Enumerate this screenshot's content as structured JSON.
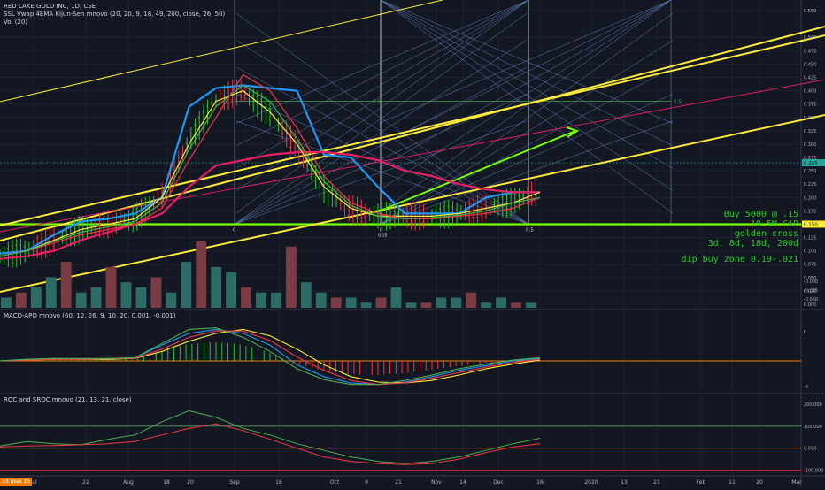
{
  "header": {
    "symbol_line": "RED LAKE GOLD INC, 1D, CSE",
    "indicator_1": "SSL Vwap 4EMA Kijun-Sen mnovo (20, 20, 9, 18, 49, 200, close, 26, 50)",
    "indicator_2": "Vol (20)"
  },
  "panes": {
    "macd_label": "MACD-APO mnovo (60, 12, 26, 9, 10, 20, 0.001, -0.001)",
    "roc_label": "ROC and SROC mnovo (21, 13, 21, close)"
  },
  "annotations": {
    "line1": "Buy 5000 @ .15",
    "line2": "10.5M CAP",
    "line3": "golden cross",
    "line4": "3d, 8d, 18d, 200d",
    "line5": "dip buy zone 0.19-.021"
  },
  "fib_labels": [
    "0.5",
    "0.5",
    "0.5",
    "0",
    "0",
    "0.5",
    "005"
  ],
  "bottom_left_badge": "1d max 15",
  "chart_data": [
    {
      "type": "line",
      "pane": "price",
      "x_ticks": [
        "Jul",
        "22",
        "Aug",
        "18",
        "20",
        "Sep",
        "16",
        "Oct",
        "9",
        "21",
        "Nov",
        "14",
        "Dec",
        "16",
        "2020",
        "13",
        "21",
        "Feb",
        "11",
        "20",
        "Mar"
      ],
      "y_ticks": [
        0.55,
        0.5,
        0.475,
        0.45,
        0.425,
        0.4,
        0.375,
        0.35,
        0.325,
        0.3,
        0.275,
        0.25,
        0.225,
        0.2,
        0.175,
        0.15,
        0.125,
        0.1,
        0.075,
        0.05,
        0.025,
        0.0
      ],
      "price_badges": [
        {
          "value": "0.265",
          "color": "#26a69a"
        },
        {
          "value": "0.150",
          "color": "#ffeb3b"
        }
      ],
      "horizontal_lines": [
        0.15,
        0.265
      ],
      "ylim": [
        0.0,
        0.56
      ],
      "series": [
        {
          "color": "#2196f3",
          "values": [
            0.095,
            0.1,
            0.13,
            0.155,
            0.16,
            0.17,
            0.2,
            0.37,
            0.405,
            0.41,
            0.405,
            0.4,
            0.28,
            0.275,
            0.22,
            0.17,
            0.17,
            0.17,
            0.2,
            0.21,
            0.21
          ]
        },
        {
          "color": "#e91e63",
          "values": [
            0.085,
            0.09,
            0.1,
            0.12,
            0.135,
            0.15,
            0.17,
            0.22,
            0.26,
            0.27,
            0.28,
            0.285,
            0.285,
            0.28,
            0.27,
            0.25,
            0.24,
            0.225,
            0.215,
            0.21,
            0.21
          ]
        },
        {
          "color": "#ffeb3b",
          "values": [
            0.09,
            0.1,
            0.12,
            0.14,
            0.15,
            0.16,
            0.2,
            0.3,
            0.38,
            0.4,
            0.36,
            0.3,
            0.22,
            0.18,
            0.165,
            0.165,
            0.165,
            0.17,
            0.18,
            0.19,
            0.21
          ]
        },
        {
          "color": "#f23645",
          "values": [
            0.09,
            0.1,
            0.115,
            0.13,
            0.14,
            0.15,
            0.18,
            0.27,
            0.35,
            0.43,
            0.4,
            0.33,
            0.24,
            0.19,
            0.17,
            0.16,
            0.16,
            0.165,
            0.17,
            0.18,
            0.2
          ]
        },
        {
          "color": "#4caf50",
          "values": [
            0.09,
            0.1,
            0.118,
            0.135,
            0.145,
            0.155,
            0.19,
            0.29,
            0.37,
            0.41,
            0.38,
            0.31,
            0.23,
            0.185,
            0.165,
            0.16,
            0.162,
            0.167,
            0.175,
            0.19,
            0.2
          ]
        }
      ]
    },
    {
      "type": "bar",
      "pane": "volume",
      "y_ticks": [
        "-0.000",
        "-0.025",
        "-0.050"
      ],
      "values": [
        2,
        3,
        4,
        6,
        9,
        3,
        4,
        8,
        5,
        4,
        6,
        3,
        9,
        13,
        8,
        7,
        4,
        3,
        3,
        12,
        5,
        3,
        2,
        2,
        1,
        2,
        4,
        1,
        1,
        2,
        2,
        3,
        1,
        2,
        1,
        1
      ]
    },
    {
      "type": "line",
      "pane": "macd",
      "y_ticks": [
        "0",
        "-0"
      ],
      "series": [
        {
          "color": "#2196f3",
          "values": [
            0,
            0.002,
            0.003,
            0.002,
            0.003,
            0.004,
            0.02,
            0.035,
            0.04,
            0.035,
            0.02,
            -0.005,
            -0.02,
            -0.028,
            -0.03,
            -0.027,
            -0.02,
            -0.012,
            -0.006,
            0.0,
            0.003
          ]
        },
        {
          "color": "#ffeb3b",
          "values": [
            0,
            0.001,
            0.002,
            0.002,
            0.002,
            0.003,
            0.012,
            0.025,
            0.035,
            0.04,
            0.032,
            0.015,
            -0.005,
            -0.02,
            -0.027,
            -0.028,
            -0.025,
            -0.018,
            -0.01,
            -0.004,
            0.001
          ]
        },
        {
          "color": "#f23645",
          "values": [
            0,
            0.001,
            0.002,
            0.002,
            0.003,
            0.003,
            0.015,
            0.03,
            0.038,
            0.038,
            0.026,
            0.005,
            -0.012,
            -0.025,
            -0.03,
            -0.028,
            -0.022,
            -0.015,
            -0.008,
            -0.002,
            0.002
          ]
        },
        {
          "color": "#4caf50",
          "values": [
            0,
            0.002,
            0.003,
            0.003,
            0.003,
            0.004,
            0.022,
            0.04,
            0.042,
            0.03,
            0.012,
            -0.01,
            -0.024,
            -0.03,
            -0.03,
            -0.025,
            -0.018,
            -0.01,
            -0.004,
            0.001,
            0.004
          ]
        }
      ]
    },
    {
      "type": "line",
      "pane": "roc",
      "y_ticks": [
        "200.000",
        "100.000",
        "0.000",
        "-100.000"
      ],
      "series": [
        {
          "color": "#4caf50",
          "values": [
            10,
            30,
            20,
            15,
            40,
            60,
            120,
            170,
            140,
            90,
            60,
            20,
            -10,
            -40,
            -60,
            -70,
            -60,
            -40,
            -10,
            20,
            45
          ]
        },
        {
          "color": "#f23645",
          "values": [
            5,
            10,
            12,
            15,
            20,
            30,
            60,
            90,
            110,
            80,
            40,
            0,
            -40,
            -60,
            -70,
            -75,
            -70,
            -50,
            -20,
            5,
            20
          ]
        }
      ]
    }
  ]
}
